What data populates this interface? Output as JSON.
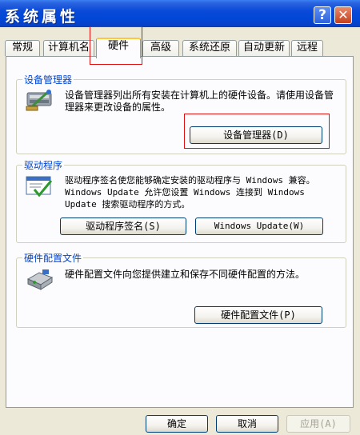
{
  "window": {
    "title": "系统属性",
    "help_symbol": "?",
    "close_symbol": "✕"
  },
  "tabs": [
    {
      "label": "常规"
    },
    {
      "label": "计算机名"
    },
    {
      "label": "硬件"
    },
    {
      "label": "高级"
    },
    {
      "label": "系统还原"
    },
    {
      "label": "自动更新"
    },
    {
      "label": "远程"
    }
  ],
  "active_tab": "硬件",
  "groups": {
    "device_manager": {
      "title": "设备管理器",
      "description": "设备管理器列出所有安装在计算机上的硬件设备。请使用设备管理器来更改设备的属性。",
      "button": "设备管理器(D)"
    },
    "drivers": {
      "title": "驱动程序",
      "description": "驱动程序签名使您能够确定安装的驱动程序与 Windows 兼容。Windows Update 允许您设置 Windows 连接到 Windows Update 搜索驱动程序的方式。",
      "button_signing": "驱动程序签名(S)",
      "button_update": "Windows Update(W)"
    },
    "hardware_profiles": {
      "title": "硬件配置文件",
      "description": "硬件配置文件向您提供建立和保存不同硬件配置的方法。",
      "button": "硬件配置文件(P)"
    }
  },
  "footer": {
    "ok": "确定",
    "cancel": "取消",
    "apply": "应用(A)"
  },
  "colors": {
    "titlebar": "#0047d6",
    "group_title": "#0046d5",
    "highlight": "#e01010",
    "face": "#ece9d8"
  }
}
